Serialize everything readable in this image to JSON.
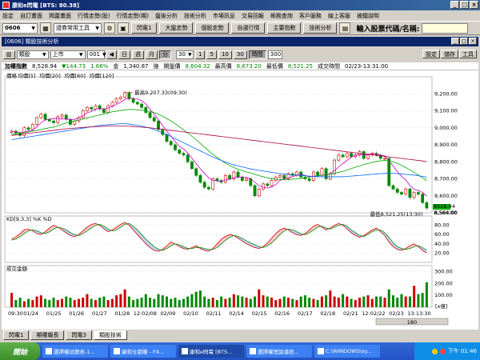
{
  "window": {
    "title": "康和e閃電 [BTS: 80.38]"
  },
  "menu": [
    "設定",
    "自訂畫面",
    "揭露畫面",
    "行情走勢(股)",
    "行情走勢(期)",
    "盤後分析",
    "技術分析",
    "市場訊息",
    "交易回報",
    "帳務查詢",
    "客戶服務",
    "線上客服",
    "被鐵說明"
  ],
  "toolbar": {
    "code": "0606",
    "tool_select": "證券常用工具",
    "buttons": [
      "閃電1",
      "大盤走勢",
      "個股走勢",
      "自選行情",
      "主要指數",
      "技術分析"
    ],
    "search_label": "輸入股票代碼/名稱:"
  },
  "subwindow": {
    "title": "[0606] 類股技術分析"
  },
  "controls": {
    "type": "類股",
    "market": "上市",
    "index_code": "001",
    "periods": [
      "日",
      "週",
      "月",
      "分"
    ],
    "minutes": "30",
    "spans": [
      "1",
      "5",
      "10",
      "30"
    ],
    "active_span": "時間",
    "count": "300",
    "right_buttons": [
      "設定",
      "儲存",
      "工具"
    ]
  },
  "info": {
    "name": "加權指數",
    "price": "8,528.94",
    "change": "▼144.73",
    "pct": "1.66%",
    "amount_label": "金",
    "amount": "1,340.87",
    "amount_unit": "億",
    "open_label": "開盤價",
    "open": "8,604.32",
    "high_label": "最高價",
    "high": "8,673.20",
    "low_label": "最低價",
    "low": "8,521.25",
    "time_label": "成交時間",
    "time": "02/23-13:31:00"
  },
  "chart_data": [
    {
      "type": "candlestick",
      "legend": [
        "價格",
        "均價[5]",
        "均價[20]",
        "均價[60]",
        "均價[120]"
      ],
      "legend_colors": [
        "#000000",
        "#cc00cc",
        "#00aa00",
        "#0066ff",
        "#aa0044"
      ],
      "ylim": [
        8500,
        9300
      ],
      "yticks": [
        "9,200.00",
        "9,100.00",
        "9,000.00",
        "8,900.00",
        "8,800.00",
        "8,700.00",
        "8,600.00",
        "8,500.00"
      ],
      "annotations": [
        {
          "text": "最高9,207.33(09:30)"
        },
        {
          "text": "最低8,521.25(13:30)"
        }
      ],
      "last_price_label": "8528.94",
      "last_price_label2": "8,564.00",
      "series": [
        {
          "name": "收盤",
          "values": [
            8980,
            8970,
            8955,
            9000,
            8990,
            9020,
            9060,
            9080,
            9050,
            9040,
            9030,
            9065,
            9075,
            9050,
            9020,
            9040,
            9060,
            9100,
            9120,
            9110,
            9130,
            9110,
            9090,
            9130,
            9150,
            9170,
            9180,
            9207,
            9170,
            9150,
            9140,
            9120,
            9090,
            9060,
            9040,
            8990,
            8960,
            8920,
            8900,
            8870,
            8850,
            8840,
            8800,
            8760,
            8720,
            8680,
            8650,
            8640,
            8700,
            8690,
            8680,
            8720,
            8700,
            8740,
            8710,
            8690,
            8700,
            8660,
            8600,
            8640,
            8670,
            8660,
            8690,
            8710,
            8720,
            8700,
            8730,
            8720,
            8740,
            8710,
            8700,
            8690,
            8740,
            8720,
            8760,
            8700,
            8730,
            8810,
            8840,
            8830,
            8850,
            8830,
            8840,
            8860,
            8820,
            8840,
            8850,
            8840,
            8820,
            8820,
            8660,
            8640,
            8620,
            8610,
            8640,
            8590,
            8620,
            8610,
            8560,
            8528
          ]
        },
        {
          "name": "均價[5]",
          "values": [
            8980,
            8978,
            8970,
            8975,
            8980,
            8987,
            9005,
            9030,
            9046,
            9050,
            9055,
            9055,
            9052,
            9052,
            9048,
            9050,
            9058,
            9070,
            9088,
            9096,
            9110,
            9114,
            9110,
            9116,
            9126,
            9138,
            9150,
            9167,
            9176,
            9173,
            9169,
            9160,
            9140,
            9110,
            9080,
            9048,
            9014,
            8980,
            8950,
            8920,
            8890,
            8876,
            8852,
            8822,
            8790,
            8758,
            8732,
            8706,
            8690,
            8688,
            8686,
            8693,
            8698,
            8706,
            8710,
            8711,
            8708,
            8700,
            8680,
            8660,
            8650,
            8646,
            8652,
            8666,
            8690,
            8700,
            8706,
            8712,
            8722,
            8726,
            8720,
            8712,
            8716,
            8716,
            8722,
            8722,
            8730,
            8748,
            8770,
            8790,
            8808,
            8828,
            8838,
            8843,
            8840,
            8844,
            8846,
            8846,
            8838,
            8835,
            8806,
            8776,
            8742,
            8714,
            8694,
            8660,
            8638,
            8632,
            8620,
            8598
          ]
        },
        {
          "name": "均價[20]",
          "values": [
            8960,
            8965,
            8968,
            8972,
            8976,
            8980,
            8985,
            8990,
            8995,
            9000,
            9005,
            9012,
            9020,
            9028,
            9035,
            9040,
            9046,
            9052,
            9058,
            9064,
            9070,
            9076,
            9082,
            9088,
            9094,
            9098,
            9102,
            9106,
            9108,
            9108,
            9106,
            9104,
            9100,
            9096,
            9090,
            9080,
            9068,
            9054,
            9040,
            9024,
            9006,
            8988,
            8970,
            8950,
            8930,
            8908,
            8886,
            8864,
            8844,
            8826,
            8808,
            8792,
            8778,
            8766,
            8756,
            8748,
            8740,
            8734,
            8726,
            8718,
            8712,
            8706,
            8702,
            8698,
            8696,
            8696,
            8696,
            8698,
            8700,
            8702,
            8706,
            8710,
            8714,
            8718,
            8722,
            8726,
            8728,
            8732,
            8738,
            8744,
            8752,
            8760,
            8768,
            8776,
            8784,
            8790,
            8796,
            8802,
            8806,
            8808,
            8806,
            8800,
            8790,
            8780,
            8766,
            8752,
            8738,
            8722,
            8706,
            8690
          ]
        },
        {
          "name": "均價[60]",
          "values": [
            8930,
            8934,
            8938,
            8942,
            8946,
            8950,
            8954,
            8958,
            8962,
            8966,
            8970,
            8974,
            8978,
            8982,
            8986,
            8990,
            8994,
            8998,
            9002,
            9006,
            9010,
            9014,
            9016,
            9018,
            9020,
            9022,
            9024,
            9024,
            9022,
            9018,
            9014,
            9010,
            9004,
            8998,
            8990,
            8980,
            8970,
            8960,
            8948,
            8936,
            8924,
            8912,
            8900,
            8888,
            8876,
            8864,
            8852,
            8840,
            8828,
            8818,
            8808,
            8798,
            8790,
            8782,
            8776,
            8770,
            8764,
            8758,
            8754,
            8750,
            8746,
            8742,
            8738,
            8734,
            8730,
            8728,
            8726,
            8724,
            8722,
            8720,
            8718,
            8716,
            8714,
            8712,
            8712,
            8712,
            8712,
            8712,
            8712,
            8712,
            8714,
            8716,
            8718,
            8720,
            8722,
            8724,
            8726,
            8728,
            8730,
            8732,
            8732,
            8732,
            8730,
            8728,
            8726,
            8724,
            8722,
            8718,
            8714,
            8710
          ]
        },
        {
          "name": "均價[120]",
          "values": [
            8955,
            8958,
            8961,
            8964,
            8967,
            8970,
            8973,
            8976,
            8979,
            8982,
            8985,
            8988,
            8991,
            8994,
            8996,
            8998,
            9000,
            9002,
            9004,
            9006,
            9007,
            9008,
            9009,
            9010,
            9010,
            9010,
            9010,
            9010,
            9009,
            9008,
            9006,
            9004,
            9002,
            9000,
            8997,
            8994,
            8991,
            8988,
            8985,
            8982,
            8979,
            8976,
            8973,
            8970,
            8967,
            8964,
            8961,
            8958,
            8955,
            8952,
            8949,
            8946,
            8943,
            8940,
            8937,
            8934,
            8931,
            8928,
            8925,
            8922,
            8919,
            8916,
            8913,
            8910,
            8907,
            8904,
            8901,
            8898,
            8895,
            8892,
            8889,
            8886,
            8883,
            8880,
            8877,
            8874,
            8871,
            8868,
            8865,
            8862,
            8859,
            8856,
            8853,
            8850,
            8847,
            8844,
            8841,
            8838,
            8835,
            8832,
            8829,
            8826,
            8823,
            8820,
            8817,
            8814,
            8811,
            8808,
            8805,
            8800
          ]
        }
      ]
    },
    {
      "type": "line",
      "legend": [
        "KD[9,3,3]",
        "%K",
        "%D"
      ],
      "ylim": [
        0,
        100
      ],
      "yticks": [
        "80.00",
        "60.00",
        "40.00",
        "20.00"
      ],
      "series": [
        {
          "name": "%K",
          "values": [
            50,
            55,
            62,
            70,
            72,
            68,
            62,
            60,
            66,
            74,
            80,
            76,
            70,
            64,
            58,
            55,
            60,
            68,
            76,
            82,
            84,
            80,
            72,
            66,
            70,
            76,
            82,
            86,
            80,
            70,
            60,
            50,
            40,
            32,
            26,
            24,
            28,
            36,
            44,
            40,
            34,
            30,
            28,
            32,
            36,
            30,
            26,
            24,
            30,
            40,
            50,
            56,
            60,
            58,
            52,
            46,
            40,
            36,
            32,
            30,
            34,
            42,
            52,
            62,
            70,
            74,
            70,
            64,
            60,
            58,
            62,
            70,
            78,
            82,
            76,
            70,
            74,
            80,
            84,
            80,
            72,
            64,
            58,
            54,
            58,
            64,
            70,
            74,
            66,
            58,
            44,
            34,
            28,
            26,
            30,
            36,
            40,
            34,
            26,
            20
          ]
        },
        {
          "name": "%D",
          "values": [
            48,
            50,
            56,
            62,
            68,
            70,
            68,
            64,
            62,
            66,
            72,
            76,
            74,
            70,
            64,
            60,
            58,
            62,
            68,
            74,
            80,
            82,
            78,
            72,
            68,
            70,
            76,
            82,
            84,
            78,
            70,
            60,
            50,
            42,
            34,
            28,
            26,
            30,
            36,
            40,
            38,
            34,
            30,
            30,
            32,
            32,
            30,
            28,
            28,
            32,
            40,
            48,
            54,
            58,
            56,
            52,
            46,
            42,
            38,
            34,
            32,
            36,
            42,
            50,
            60,
            68,
            72,
            70,
            66,
            62,
            60,
            64,
            70,
            76,
            78,
            74,
            72,
            76,
            80,
            82,
            78,
            70,
            64,
            58,
            56,
            60,
            66,
            70,
            70,
            64,
            54,
            42,
            34,
            30,
            28,
            30,
            34,
            36,
            32,
            26
          ]
        }
      ]
    },
    {
      "type": "bar",
      "legend": [
        "成交金額"
      ],
      "ylim": [
        0,
        350
      ],
      "yticks": [
        "300.00",
        "200.00",
        "100.00"
      ],
      "ylabel": "[x億]",
      "values": [
        120,
        60,
        80,
        50,
        70,
        60,
        90,
        100,
        70,
        60,
        80,
        60,
        70,
        90,
        80,
        60,
        70,
        80,
        110,
        70,
        60,
        80,
        90,
        60,
        70,
        100,
        110,
        150,
        90,
        60,
        70,
        80,
        110,
        80,
        70,
        110,
        100,
        90,
        70,
        80,
        60,
        70,
        90,
        110,
        130,
        140,
        90,
        70,
        80,
        60,
        90,
        70,
        80,
        110,
        100,
        90,
        80,
        70,
        90,
        150,
        100,
        90,
        80,
        60,
        70,
        90,
        80,
        70,
        60,
        90,
        100,
        80,
        70,
        60,
        90,
        100,
        140,
        90,
        80,
        110,
        90,
        70,
        60,
        80,
        90,
        100,
        70,
        90,
        90,
        80,
        150,
        100,
        80,
        110,
        90,
        90,
        180,
        110,
        120,
        210
      ]
    }
  ],
  "x_axis": [
    "09:30",
    "01/24",
    "01/25",
    "01/26",
    "01/27",
    "01/28",
    "12:02/08",
    "02/09",
    "02/10",
    "02/11",
    "02/14",
    "02/15",
    "02/16",
    "02/17",
    "02/18",
    "02/21",
    "12:02/22",
    "02/23",
    "13:13:30"
  ],
  "tabs": [
    "閃電1",
    "期權報長",
    "閃電3",
    "類股技術"
  ],
  "scroll_value": "180",
  "taskbar": {
    "start": "開始",
    "tasks": [
      "選擇權試題表-1...",
      "康和全都賺 - F4...",
      "康和e閃電 [BTS...",
      "選擇權理論逼程...",
      "C:\\WINDOWS\\sy..."
    ],
    "clock": "下午 01:46"
  }
}
